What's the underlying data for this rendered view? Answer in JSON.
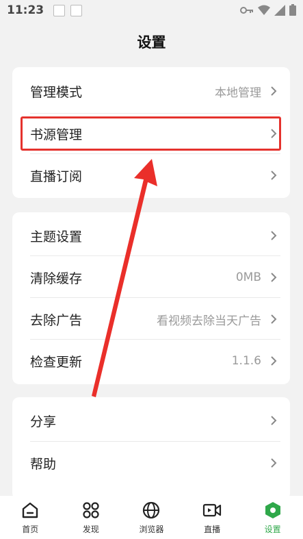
{
  "status_bar": {
    "time": "11:23"
  },
  "page": {
    "title": "设置"
  },
  "group1": [
    {
      "label": "管理模式",
      "value": "本地管理"
    },
    {
      "label": "书源管理",
      "value": ""
    },
    {
      "label": "直播订阅",
      "value": ""
    }
  ],
  "group2": [
    {
      "label": "主题设置",
      "value": ""
    },
    {
      "label": "清除缓存",
      "value": "0MB"
    },
    {
      "label": "去除广告",
      "value": "看视频去除当天广告"
    },
    {
      "label": "检查更新",
      "value": "1.1.6"
    }
  ],
  "group3": [
    {
      "label": "分享",
      "value": ""
    },
    {
      "label": "帮助",
      "value": ""
    }
  ],
  "tabs": [
    {
      "label": "首页",
      "icon": "home-icon"
    },
    {
      "label": "发现",
      "icon": "discover-icon"
    },
    {
      "label": "浏览器",
      "icon": "browser-icon"
    },
    {
      "label": "直播",
      "icon": "live-icon"
    },
    {
      "label": "设置",
      "icon": "settings-icon"
    }
  ],
  "colors": {
    "accent": "#2fa84a",
    "highlight": "#e5322d"
  }
}
